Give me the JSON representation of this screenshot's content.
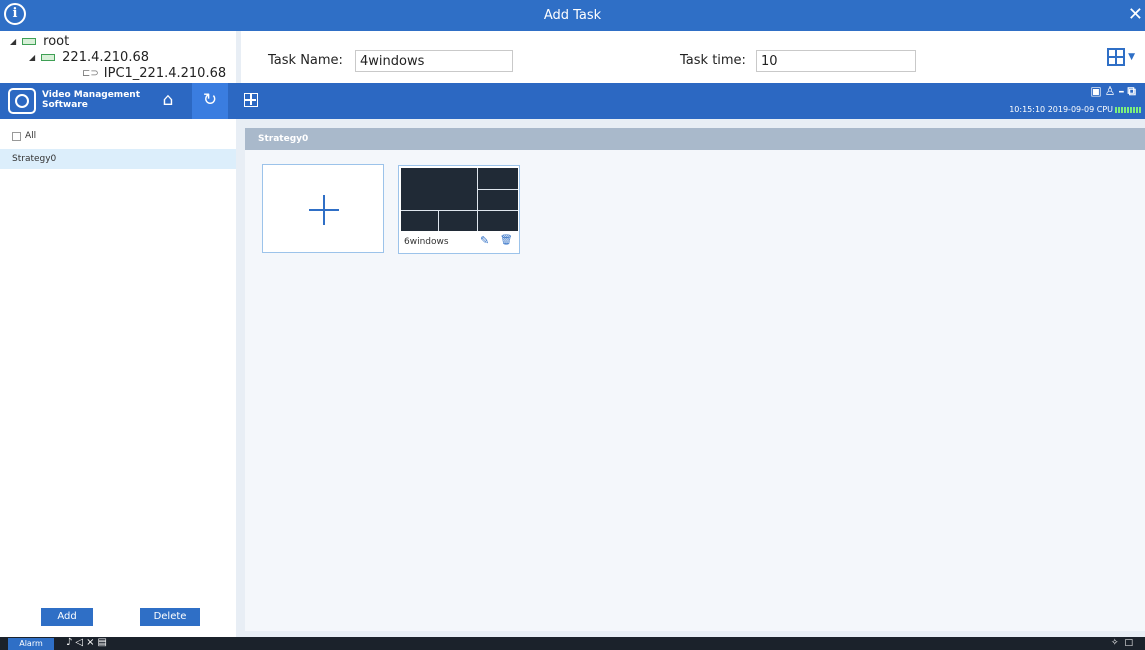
{
  "dialog": {
    "title": "Add Task"
  },
  "tree": {
    "root": "root",
    "device": "221.4.210.68",
    "camera": "IPC1_221.4.210.68"
  },
  "form": {
    "task_name_label": "Task Name:",
    "task_name_value": "4windows",
    "task_time_label": "Task time:",
    "task_time_value": "10"
  },
  "app": {
    "name_line1": "Video Management",
    "name_line2": "Software",
    "status_text": "10:15:10 2019-09-09 CPU"
  },
  "left_panel": {
    "all_label": "All",
    "strategies": [
      "Strategy0"
    ],
    "add_button": "Add",
    "delete_button": "Delete"
  },
  "main": {
    "group_title": "Strategy0",
    "layouts": [
      {
        "name": "6windows"
      }
    ]
  },
  "taskbar": {
    "alarm_label": "Alarm"
  },
  "colors": {
    "accent": "#2f6fc6",
    "header": "#2c68c2",
    "selected_row": "#dceefb",
    "group_header": "#a9b9cb"
  }
}
